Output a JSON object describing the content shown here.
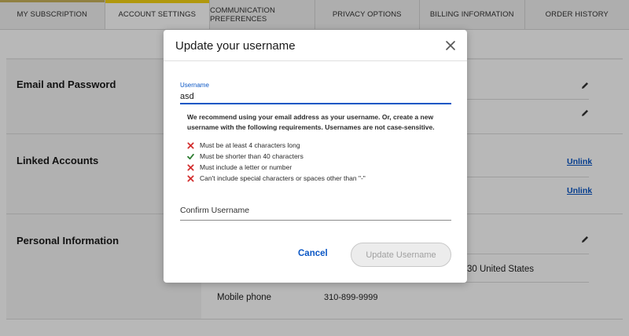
{
  "tabs": [
    {
      "label": "MY SUBSCRIPTION"
    },
    {
      "label": "ACCOUNT SETTINGS"
    },
    {
      "label": "COMMUNICATION PREFERENCES"
    },
    {
      "label": "PRIVACY OPTIONS"
    },
    {
      "label": "BILLING INFORMATION"
    },
    {
      "label": "ORDER HISTORY"
    }
  ],
  "sections": {
    "email_password": {
      "title": "Email and Password"
    },
    "linked_accounts": {
      "title": "Linked Accounts",
      "unlink_label": "Unlink"
    },
    "personal_info": {
      "title": "Personal Information",
      "address_partial": "30 United States",
      "mobile_label": "Mobile phone",
      "mobile_value": "310-899-9999"
    }
  },
  "modal": {
    "title": "Update your username",
    "username_label": "Username",
    "username_value": "asd",
    "hint": "We recommend using your email address as your username. Or, create a new username with the following requirements. Usernames are not case-sensitive.",
    "requirements": [
      {
        "text": "Must be at least 4 characters long",
        "status": "fail"
      },
      {
        "text": "Must be shorter than 40 characters",
        "status": "pass"
      },
      {
        "text": "Must include a letter or number",
        "status": "fail"
      },
      {
        "text": "Can't include special characters or spaces other than \"-\"",
        "status": "fail"
      }
    ],
    "confirm_label": "Confirm Username",
    "cancel_label": "Cancel",
    "update_label": "Update Username"
  },
  "colors": {
    "accent_blue": "#0b57c5",
    "fail_red": "#d32f2f",
    "pass_green": "#2e7d32",
    "tab_highlight": "#f5d312"
  }
}
